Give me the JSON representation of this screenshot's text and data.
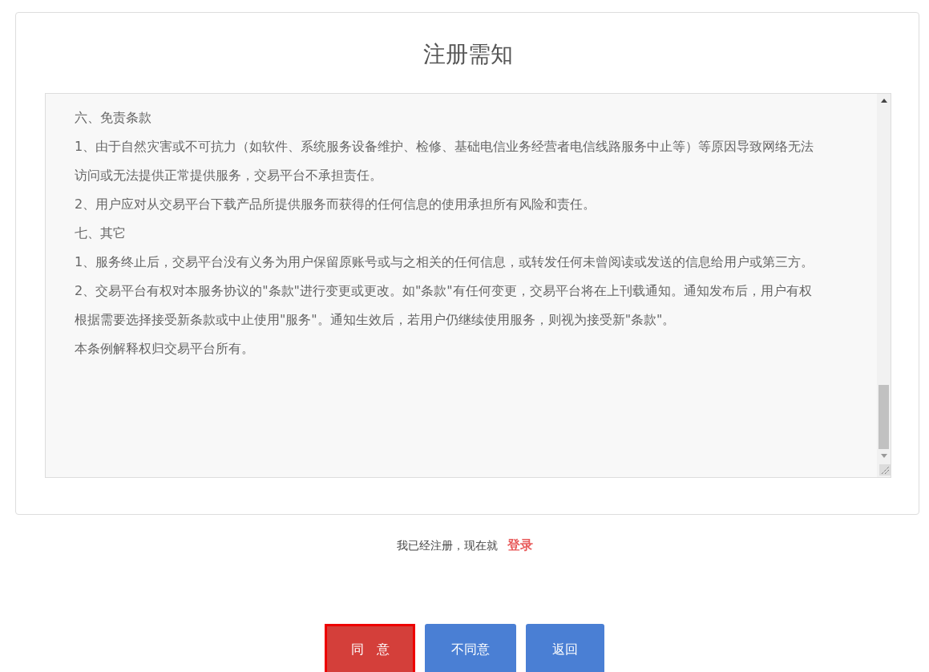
{
  "title": "注册需知",
  "agreement": {
    "paragraphs": [
      "六、免责条款",
      "1、由于自然灾害或不可抗力（如软件、系统服务设备维护、检修、基础电信业务经营者电信线路服务中止等）等原因导致网络无法访问或无法提供正常提供服务，交易平台不承担责任。",
      "2、用户应对从交易平台下载产品所提供服务而获得的任何信息的使用承担所有风险和责任。",
      "七、其它",
      "1、服务终止后，交易平台没有义务为用户保留原账号或与之相关的任何信息，或转发任何未曾阅读或发送的信息给用户或第三方。",
      "2、交易平台有权对本服务协议的\"条款\"进行变更或更改。如\"条款\"有任何变更，交易平台将在上刊载通知。通知发布后，用户有权根据需要选择接受新条款或中止使用\"服务\"。通知生效后，若用户仍继续使用服务，则视为接受新\"条款\"。",
      "本条例解释权归交易平台所有。"
    ]
  },
  "login_prompt": {
    "text": "我已经注册，现在就",
    "link": "登录"
  },
  "buttons": [
    {
      "label": "同　意",
      "kind": "primary",
      "focused": true
    },
    {
      "label": "不同意",
      "kind": "secondary",
      "focused": false
    },
    {
      "label": "返回",
      "kind": "secondary",
      "focused": false
    }
  ]
}
